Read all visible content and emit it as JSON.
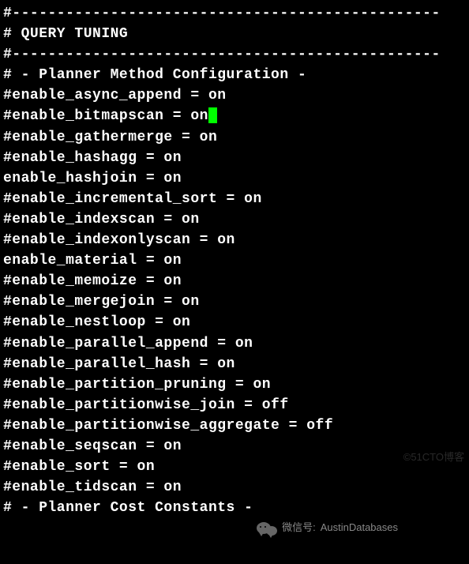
{
  "lines": [
    {
      "text": "#------------------------------------------------"
    },
    {
      "text": "# QUERY TUNING"
    },
    {
      "text": "#------------------------------------------------"
    },
    {
      "text": ""
    },
    {
      "text": "# - Planner Method Configuration -"
    },
    {
      "text": ""
    },
    {
      "text": "#enable_async_append = on"
    },
    {
      "text": "#enable_bitmapscan = on",
      "cursor": true
    },
    {
      "text": "#enable_gathermerge = on"
    },
    {
      "text": "#enable_hashagg = on"
    },
    {
      "text": "enable_hashjoin = on"
    },
    {
      "text": "#enable_incremental_sort = on"
    },
    {
      "text": "#enable_indexscan = on"
    },
    {
      "text": "#enable_indexonlyscan = on"
    },
    {
      "text": "enable_material = on"
    },
    {
      "text": "#enable_memoize = on"
    },
    {
      "text": "#enable_mergejoin = on"
    },
    {
      "text": "#enable_nestloop = on"
    },
    {
      "text": "#enable_parallel_append = on"
    },
    {
      "text": "#enable_parallel_hash = on"
    },
    {
      "text": "#enable_partition_pruning = on"
    },
    {
      "text": "#enable_partitionwise_join = off"
    },
    {
      "text": "#enable_partitionwise_aggregate = off"
    },
    {
      "text": "#enable_seqscan = on"
    },
    {
      "text": "#enable_sort = on"
    },
    {
      "text": "#enable_tidscan = on"
    },
    {
      "text": ""
    },
    {
      "text": "# - Planner Cost Constants -"
    }
  ],
  "attribution": {
    "prefix": "微信号:",
    "name": "AustinDatabases"
  },
  "watermark": "©51CTO博客"
}
